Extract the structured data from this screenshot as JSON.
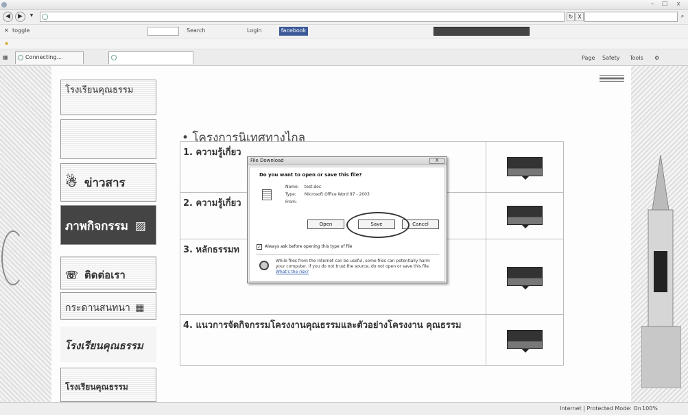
{
  "window": {
    "title": "",
    "buttons": {
      "minimize": "–",
      "maximize": "□",
      "close": "x"
    }
  },
  "address_bar": {
    "url": "",
    "search_placeholder": "",
    "refresh_glyph": "↻",
    "stop_glyph": "X"
  },
  "toolbar": {
    "toggle_label": "toggle",
    "search_label": "Search",
    "login_label": "Login",
    "facebook_label": "facebook"
  },
  "tabs": [
    {
      "label": "Connecting..."
    },
    {
      "label": ""
    }
  ],
  "command_bar": {
    "page_label": "Page",
    "safety_label": "Safety",
    "tools_label": "Tools"
  },
  "page": {
    "breadcrumb": "",
    "title": "• โครงการนิเทศทางไกล",
    "table_caption": "",
    "rows": [
      {
        "number": "1.",
        "title": "ความรู้เกี่ยว"
      },
      {
        "number": "2.",
        "title": "ความรู้เกี่ยว"
      },
      {
        "number": "3.",
        "title": "หลักธรรมท"
      },
      {
        "number": "4.",
        "title": "แนวการจัดกิจกรรมโครงงานคุณธรรมและตัวอย่างโครงงาน คุณธรรม"
      }
    ]
  },
  "sidebar": {
    "banners": [
      {
        "text": "โรงเรียนคุณธรรม"
      },
      {
        "text": ""
      },
      {
        "text": "ข่าวสาร"
      },
      {
        "text": "ภาพกิจกรรม"
      },
      {
        "text": "ติดต่อเรา"
      },
      {
        "text": "กระดานสนทนา"
      },
      {
        "text": "โรงเรียนคุณธรรม"
      },
      {
        "text": "โรงเรียนคุณธรรม"
      }
    ]
  },
  "dialog": {
    "title": "File Download",
    "close_label": "X",
    "question": "Do you want to open or save this file?",
    "fields": [
      {
        "label": "Name:",
        "value": "test.doc"
      },
      {
        "label": "Type:",
        "value": "Microsoft Office Word 97 - 2003"
      },
      {
        "label": "From:",
        "value": ""
      }
    ],
    "buttons": {
      "open": "Open",
      "save": "Save",
      "cancel": "Cancel"
    },
    "checkbox_checked": true,
    "checkbox_label": "Always ask before opening this type of file",
    "warning": "While files from the Internet can be useful, some files can potentially harm your computer. If you do not trust the source, do not open or save this file.",
    "warning_link": "What's the risk?"
  },
  "status_bar": {
    "text": "",
    "zone": "Internet | Protected Mode: On",
    "zoom": "100%"
  },
  "colors": {
    "facebook": "#3b5998",
    "dialog_bg": "#ececec",
    "link": "#2255aa"
  }
}
